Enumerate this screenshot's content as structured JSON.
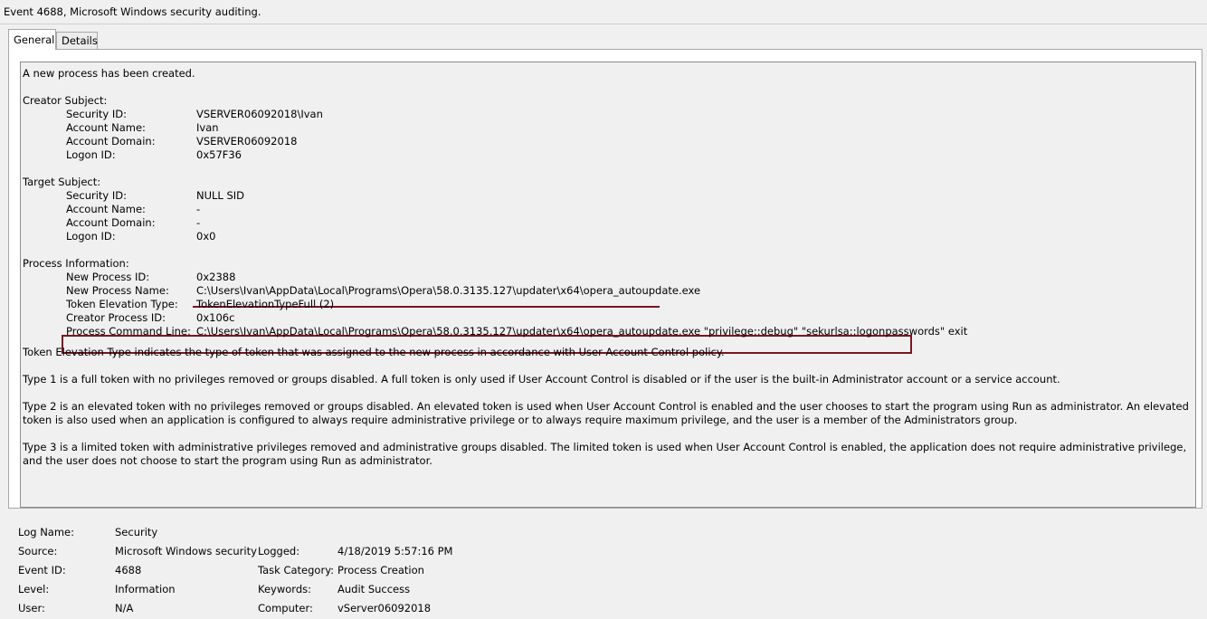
{
  "window": {
    "title": "Event 4688, Microsoft Windows security auditing."
  },
  "tabs": [
    {
      "label": "General",
      "active": true
    },
    {
      "label": "Details",
      "active": false
    }
  ],
  "description": {
    "intro": "A new process has been created.",
    "creator_subject": {
      "heading": "Creator Subject:",
      "rows": [
        {
          "label": "Security ID:",
          "value": "VSERVER06092018\\Ivan"
        },
        {
          "label": "Account Name:",
          "value": "Ivan"
        },
        {
          "label": "Account Domain:",
          "value": "VSERVER06092018"
        },
        {
          "label": "Logon ID:",
          "value": "0x57F36"
        }
      ]
    },
    "target_subject": {
      "heading": "Target Subject:",
      "rows": [
        {
          "label": "Security ID:",
          "value": "NULL SID"
        },
        {
          "label": "Account Name:",
          "value": "-"
        },
        {
          "label": "Account Domain:",
          "value": "-"
        },
        {
          "label": "Logon ID:",
          "value": "0x0"
        }
      ]
    },
    "process_info": {
      "heading": "Process Information:",
      "rows": [
        {
          "label": "New Process ID:",
          "value": "0x2388"
        },
        {
          "label": "New Process Name:",
          "value": "C:\\Users\\Ivan\\AppData\\Local\\Programs\\Opera\\58.0.3135.127\\updater\\x64\\opera_autoupdate.exe"
        },
        {
          "label": "Token Elevation Type:",
          "value": "TokenElevationTypeFull (2)"
        },
        {
          "label": "Creator Process ID:",
          "value": "0x106c"
        },
        {
          "label": "Process Command Line:",
          "value": "C:\\Users\\Ivan\\AppData\\Local\\Programs\\Opera\\58.0.3135.127\\updater\\x64\\opera_autoupdate.exe  \"privilege::debug\" \"sekurlsa::logonpasswords\" exit"
        }
      ]
    },
    "paragraphs": [
      "Token Elevation Type indicates the type of token that was assigned to the new process in accordance with User Account Control policy.",
      "Type 1 is a full token with no privileges removed or groups disabled.  A full token is only used if User Account Control is disabled or if the user is the built-in Administrator account or a service account.",
      "Type 2 is an elevated token with no privileges removed or groups disabled.  An elevated token is used when User Account Control is enabled and the user chooses to start the program using Run as administrator.  An elevated token is also used when an application is configured to always require administrative privilege or to always require maximum privilege, and the user is a member of the Administrators group.",
      "Type 3 is a limited token with administrative privileges removed and administrative groups disabled.  The limited token is used when User Account Control is enabled, the application does not require administrative privilege, and the user does not choose to start the program using Run as administrator."
    ]
  },
  "footer": {
    "log_name_label": "Log Name:",
    "log_name": "Security",
    "source_label": "Source:",
    "source": "Microsoft Windows security",
    "logged_label": "Logged:",
    "logged": "4/18/2019 5:57:16 PM",
    "event_id_label": "Event ID:",
    "event_id": "4688",
    "task_category_label": "Task Category:",
    "task_category": "Process Creation",
    "level_label": "Level:",
    "level": "Information",
    "keywords_label": "Keywords:",
    "keywords": "Audit Success",
    "user_label": "User:",
    "user": "N/A",
    "computer_label": "Computer:",
    "computer": "vServer06092018"
  },
  "colors": {
    "highlight": "#7a1422"
  }
}
